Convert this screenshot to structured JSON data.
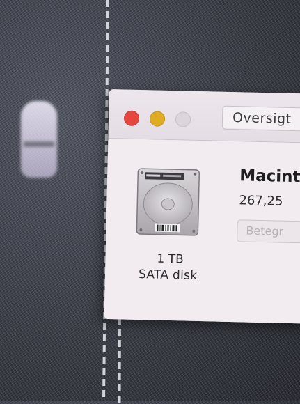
{
  "window": {
    "tab_label": "Oversigt"
  },
  "disk": {
    "icon": "hard-disk-icon",
    "size": "1 TB",
    "type": "SATA disk"
  },
  "volume": {
    "name": "Macint",
    "capacity": "267,25",
    "button_label": "Betegr"
  },
  "colors": {
    "close": "#e5463e",
    "minimize": "#e0ac23",
    "zoom": "#ddd5dc"
  }
}
